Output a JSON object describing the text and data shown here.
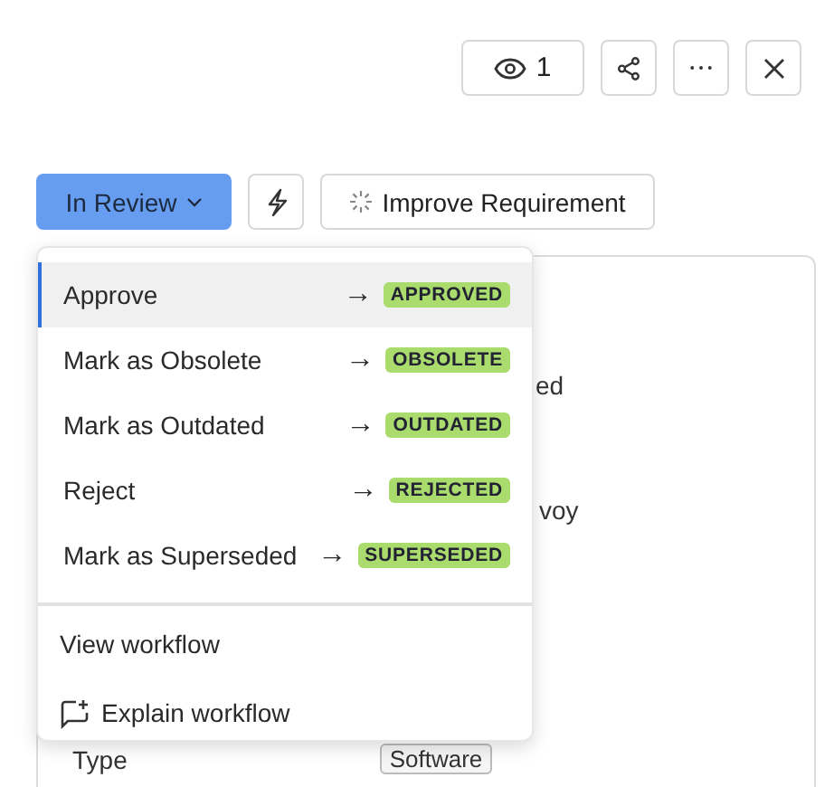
{
  "header_actions": {
    "viewers": "1"
  },
  "toolbar": {
    "status": "In Review",
    "improve": "Improve Requirement"
  },
  "status_menu": {
    "transitions": [
      {
        "label": "Approve",
        "target": "APPROVED",
        "selected": true
      },
      {
        "label": "Mark as Obsolete",
        "target": "OBSOLETE",
        "selected": false
      },
      {
        "label": "Mark as Outdated",
        "target": "OUTDATED",
        "selected": false
      },
      {
        "label": "Reject",
        "target": "REJECTED",
        "selected": false
      },
      {
        "label": "Mark as Superseded",
        "target": "SUPERSEDED",
        "selected": false
      }
    ],
    "arrow": "→",
    "actions": [
      {
        "label": "View workflow",
        "kind": "plain"
      },
      {
        "label": "Explain workflow",
        "kind": "ai"
      }
    ]
  },
  "details": {
    "fragment_1": "ed",
    "fragment_2": "voy",
    "type_label": "Type",
    "type_value": "Software"
  }
}
